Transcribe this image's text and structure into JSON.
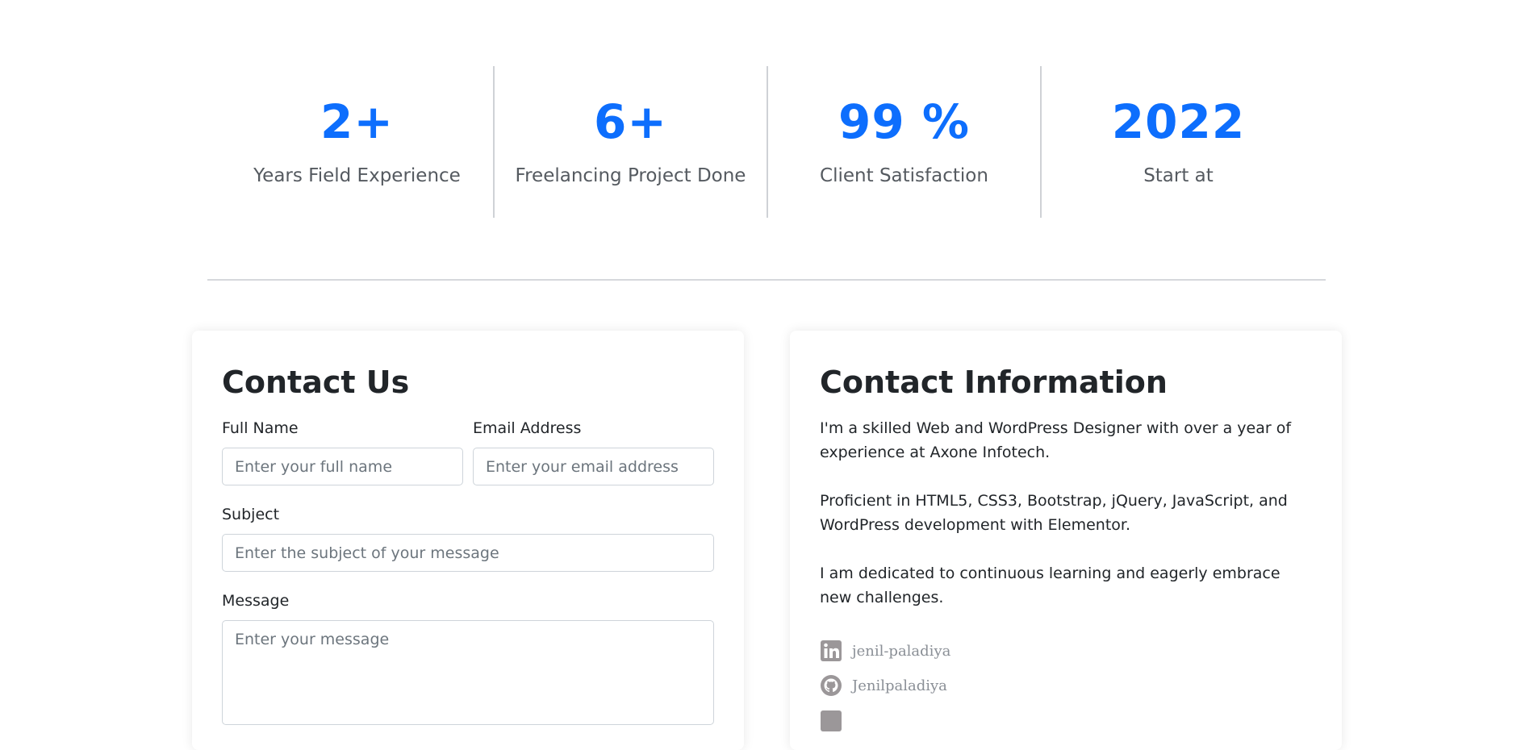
{
  "stats": [
    {
      "value": "2+",
      "label": "Years Field Experience"
    },
    {
      "value": "6+",
      "label": "Freelancing Project Done"
    },
    {
      "value": "99 %",
      "label": "Client Satisfaction"
    },
    {
      "value": "2022",
      "label": "Start at"
    }
  ],
  "contact_form": {
    "title": "Contact Us",
    "full_name_label": "Full Name",
    "full_name_placeholder": "Enter your full name",
    "email_label": "Email Address",
    "email_placeholder": "Enter your email address",
    "subject_label": "Subject",
    "subject_placeholder": "Enter the subject of your message",
    "message_label": "Message",
    "message_placeholder": "Enter your message"
  },
  "contact_info": {
    "title": "Contact Information",
    "paragraphs": [
      "I'm a skilled Web and WordPress Designer with over a year of experience at Axone Infotech.",
      "Proficient in HTML5, CSS3, Bootstrap, jQuery, JavaScript, and WordPress development with Elementor.",
      "I am dedicated to continuous learning and eagerly embrace new challenges."
    ],
    "socials": [
      {
        "icon": "linkedin-icon",
        "handle": "jenil-paladiya"
      },
      {
        "icon": "github-icon",
        "handle": "Jenilpaladiya"
      }
    ]
  },
  "colors": {
    "accent": "#0d6efd",
    "muted_text": "#555a60",
    "social_icon": "#9b9799"
  }
}
